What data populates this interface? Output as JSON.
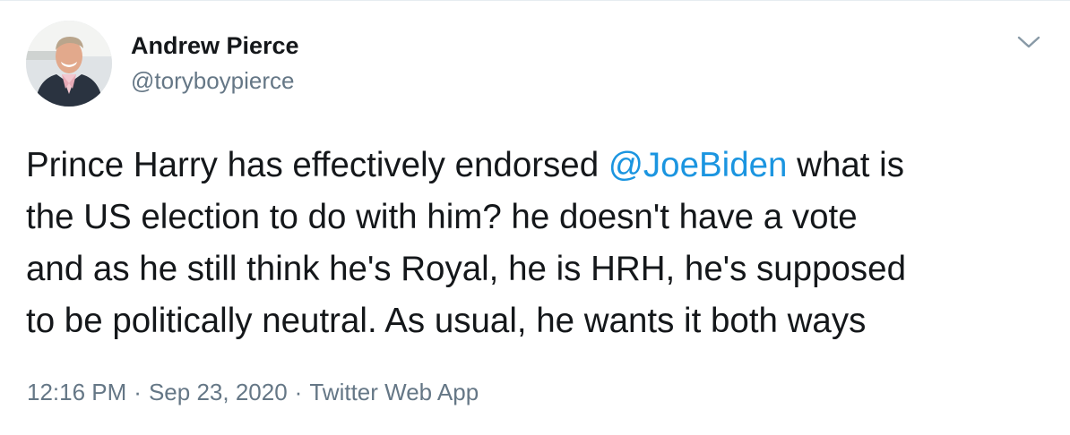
{
  "author": {
    "display_name": "Andrew Pierce",
    "handle": "@toryboypierce",
    "avatar_icon": "avatar-photo"
  },
  "tweet": {
    "lines": [
      [
        "Prince Harry has effectively endorsed ",
        "@JoeBiden",
        " what is"
      ],
      [
        "the US election to do with him? he doesn't have a vote"
      ],
      [
        "and as he still think he's Royal, he is HRH, he's supposed"
      ],
      [
        "to be politically neutral. As usual, he wants it both ways"
      ]
    ]
  },
  "meta": {
    "time": "12:16 PM",
    "separator": "·",
    "date": "Sep 23, 2020",
    "source": "Twitter Web App"
  },
  "menu_icon": "chevron-down-icon",
  "colors": {
    "text": "#14171a",
    "secondary": "#657786",
    "mention": "#1b95e0",
    "border": "#e6ecf0"
  }
}
